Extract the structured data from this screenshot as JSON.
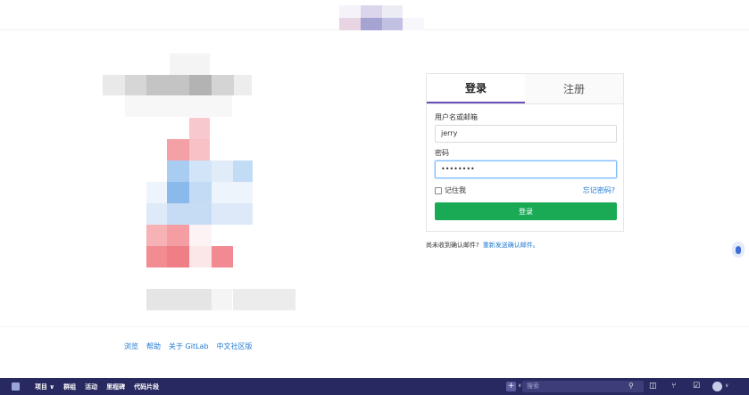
{
  "login": {
    "tabs": [
      "登录",
      "注册"
    ],
    "username_label": "用户名或邮箱",
    "username_value": "jerry",
    "password_label": "密码",
    "password_value": "••••••••",
    "remember_label": "记住我",
    "forgot_label": "忘记密码?",
    "submit_label": "登录"
  },
  "confirm": {
    "text": "尚未收到确认邮件?",
    "link": "重新发送确认邮件。"
  },
  "footer": {
    "links": [
      "浏览",
      "帮助",
      "关于 GitLab",
      "中文社区版"
    ]
  },
  "taskbar": {
    "nav": [
      "项目 ∨",
      "群组",
      "活动",
      "里程碑",
      "代码片段"
    ],
    "search_placeholder": "搜索"
  },
  "colors": {
    "brand": "#6b4fbb",
    "submit": "#1aaa55",
    "link": "#1f78d1",
    "taskbar": "#292961"
  }
}
